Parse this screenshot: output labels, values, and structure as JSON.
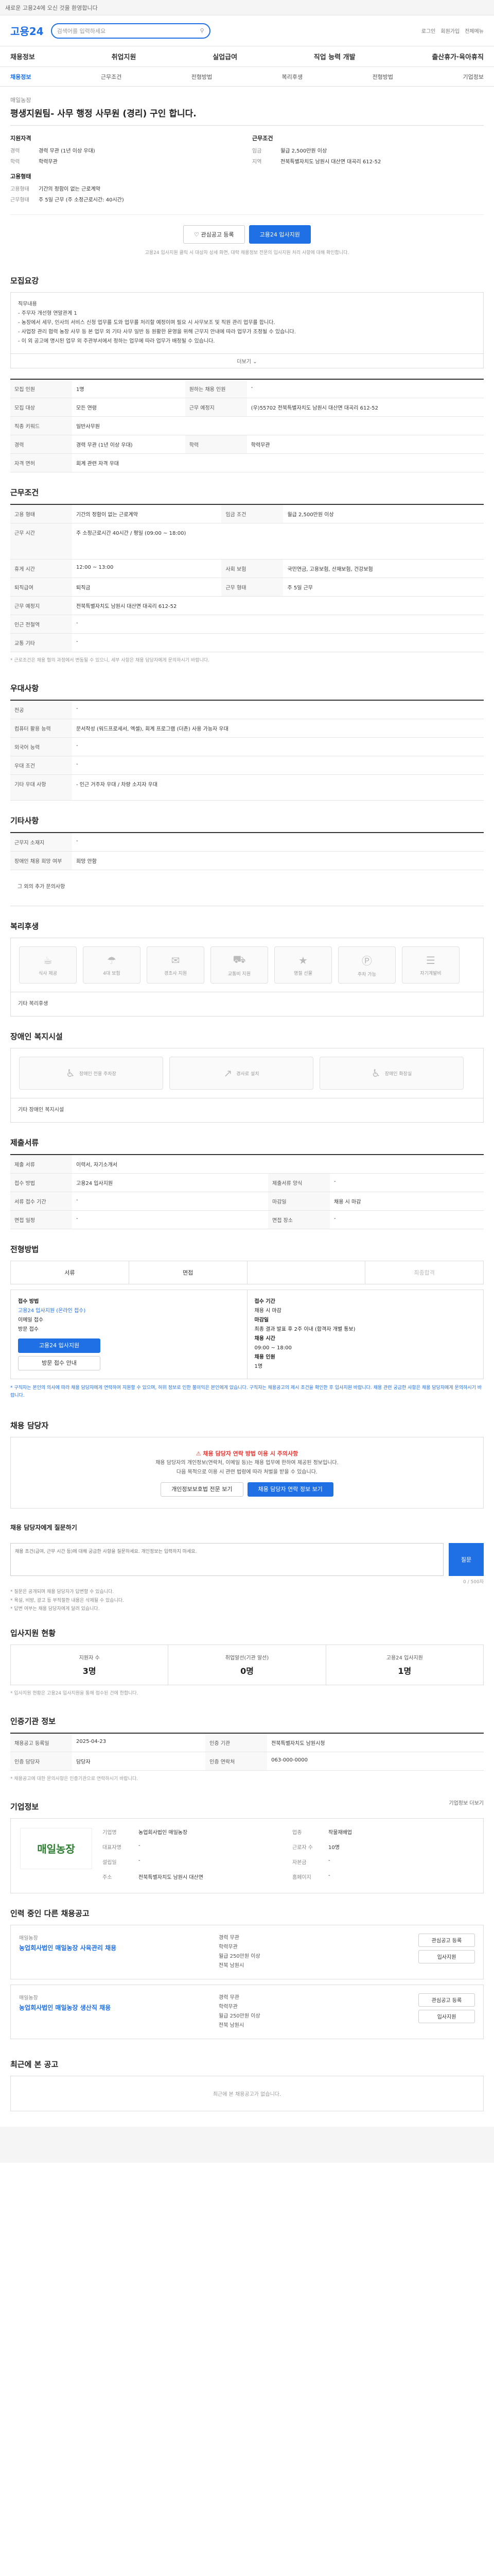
{
  "topbar": {
    "text": "새로운 고용24에 오신 것을 환영합니다"
  },
  "header": {
    "logo": "고용24",
    "search_placeholder": "검색어를 입력하세요",
    "links": [
      "로그인",
      "회원가입",
      "전체메뉴"
    ]
  },
  "gnb": [
    "채용정보",
    "취업지원",
    "실업급여",
    "직업 능력 개발",
    "출산휴가·육아휴직"
  ],
  "tabs": [
    "채용정보",
    "근무조건",
    "전형방법",
    "복리후생",
    "전형방법",
    "기업정보"
  ],
  "job": {
    "company": "매일농장",
    "title": "평생지원팀- 사무 행정 사무원 (경리) 구인 합니다."
  },
  "summary": {
    "left_title": "지원자격",
    "left": [
      {
        "k": "경력",
        "v": "경력 무관 (1년 이상 우대)"
      },
      {
        "k": "학력",
        "v": "학력무관"
      }
    ],
    "left2_title": "고용형태",
    "left2": [
      {
        "k": "고용형태",
        "v": "기간의 정함이 없는 근로계약"
      },
      {
        "k": "근무형태",
        "v": "주 5일 근무 (주 소정근로시간: 40시간)"
      }
    ],
    "right_title": "근무조건",
    "right": [
      {
        "k": "임금",
        "v": "월급 2,500만원 이상"
      },
      {
        "k": "지역",
        "v": "전북특별자치도 남원시 대산면 대곡리 612-52"
      }
    ]
  },
  "actions": {
    "scrap": "관심공고 등록",
    "apply": "고용24 입사지원"
  },
  "apply_note": "고용24 입사지원 클릭 시 대상자 상세 화면, 대략 채용정보 전문의 입사지원 처리 사항에 대해 확인합니다.",
  "recruit_title": "모집요강",
  "recruit_text": [
    "직무내용",
    "- 주무자 개선형 연말관계 1",
    "- 농장에서 세무, 인사의 서비스 신청 업무를 도와 업무를 처리할 예정이며 필요 시 사무보조 및 직원 관리 업무를 합니다.",
    "- 사업장 관리 협력 농장 사무 등 본 업무 외 기타 사무 일반 등 원활한 운영을 위해 근무지 안내에 따라 업무가 조정될 수 있습니다.",
    "- 이 외 공고에 명시된 업무 외 주관부서에서 정하는 업무에 따라 업무가 배정될 수 있습니다."
  ],
  "more_label": "더보기",
  "recruit_table": [
    {
      "k": "모집 인원",
      "v": "1명",
      "k2": "원하는 채용 인원",
      "v2": "-"
    },
    {
      "k": "모집 대상",
      "v": "모든 연령",
      "k2": "근무 예정지",
      "v2": "(우)55702 전북특별자치도 남원시 대산면 대곡리 612-52"
    },
    {
      "k": "직종 키워드",
      "v": "일반사무원",
      "k2": "",
      "v2": ""
    },
    {
      "k": "경력",
      "v": "경력 무관 (1년 이상 우대)",
      "k2": "학력",
      "v2": "학력무관"
    },
    {
      "k": "자격 면허",
      "v": "회계 관련 자격 우대",
      "k2": "",
      "v2": ""
    }
  ],
  "work_title": "근무조건",
  "work_table": [
    {
      "k": "고용 형태",
      "v": "기간의 정함이 없는 근로계약",
      "k2": "임금 조건",
      "v2": "월급 2,500만원 이상"
    },
    {
      "k": "근무 시간",
      "v": "주 소정근로시간 40시간 / 평일 (09:00 ~ 18:00)",
      "k2": "",
      "v2": ""
    },
    {
      "k": "휴게 시간",
      "v": "12:00 ~ 13:00",
      "k2": "사회 보험",
      "v2": "국민연금, 고용보험, 산재보험, 건강보험"
    },
    {
      "k": "퇴직급여",
      "v": "퇴직금",
      "k2": "근무 형태",
      "v2": "주 5일 근무"
    },
    {
      "k": "근무 예정지",
      "v": "전북특별자치도 남원시 대산면 대곡리 612-52",
      "k2": "",
      "v2": ""
    },
    {
      "k": "인근 전철역",
      "v": "-",
      "k2": "",
      "v2": ""
    },
    {
      "k": "교통 기타",
      "v": "-",
      "k2": "",
      "v2": ""
    }
  ],
  "work_note": "* 근로조건은 채용 협의 과정에서 변동될 수 있으니, 세부 사항은 채용 담당자에게 문의하시기 바랍니다.",
  "pref_title": "우대사항",
  "pref_table": [
    {
      "k": "전공",
      "v": "-"
    },
    {
      "k": "컴퓨터 활용 능력",
      "v": "문서작성 (워드프로세서, 엑셀), 회계 프로그램 (더존) 사용 가능자 우대"
    },
    {
      "k": "외국어 능력",
      "v": "-"
    },
    {
      "k": "우대 조건",
      "v": "-"
    },
    {
      "k": "기타 우대 사항",
      "v": "- 인근 거주자 우대 / 차량 소지자 우대"
    }
  ],
  "other_title": "기타사항",
  "other_table": [
    {
      "k": "근무지 소재지",
      "v": "-"
    },
    {
      "k": "장애인 채용 희망 여부",
      "v": "희망 안함"
    }
  ],
  "other_more": "그 외의 추가 문의사항",
  "welfare_title": "복리후생",
  "welfare_icons": [
    "식사 제공",
    "4대 보험",
    "경조사 지원",
    "교통비 지원",
    "명절 선물",
    "주차 가능",
    "자기계발비",
    "휴게실"
  ],
  "welfare_extra_label": "기타 복리후생",
  "disabled_title": "장애인 복지시설",
  "disabled_icons": [
    "장애인 전용 주차장",
    "경사로 설치",
    "장애인 화장실"
  ],
  "disabled_extra_label": "기타 장애인 복지시설",
  "doc_title": "제출서류",
  "doc_table": [
    {
      "k": "제출 서류",
      "v": "이력서, 자기소개서",
      "k2": "",
      "v2": ""
    },
    {
      "k": "접수 방법",
      "v": "고용24 입사지원",
      "k2": "제출서류 양식",
      "v2": "-"
    },
    {
      "k": "서류 접수 기간",
      "v": "-",
      "k2": "마감일",
      "v2": "채용 시 마감"
    },
    {
      "k": "면접 일정",
      "v": "-",
      "k2": "면접 장소",
      "v2": "-"
    }
  ],
  "process_title": "전형방법",
  "process_steps": [
    "서류",
    "면접",
    "",
    "최종합격"
  ],
  "apply_left": [
    "접수 방법",
    "고용24 입사지원 (온라인 접수)",
    "이메일 접수",
    "방문 접수"
  ],
  "apply_left_btns": [
    "고용24 입사지원",
    "방문 접수 안내"
  ],
  "apply_right": [
    "접수 기간",
    "채용 시 마감",
    "마감일",
    "최종 결과 발표 후 2주 이내 (합격자 개별 통보)",
    "채용 시간",
    "09:00 ~ 18:00",
    "채용 인원",
    "1명"
  ],
  "apply_notes": "* 구직자는 본인의 의사에 따라 채용 담당자에게 연락하여 지원할 수 있으며, 허위 정보로 인한 불이익은 본인에게 있습니다. 구직자는 채용공고의 제시 조건을 확인한 후 입사지원 바랍니다. 채용 관련 궁금한 사항은 채용 담당자에게 문의하시기 바랍니다.",
  "contact_title": "채용 담당자",
  "warn": {
    "title": "채용 담당자 연락 방법 이용 시 주의사항",
    "line1": "채용 담당자의 개인정보(연락처, 이메일 등)는 채용 업무에 한하여 제공된 정보입니다.",
    "line2": "다음 목적으로 이용 시 관련 법령에 따라 처벌을 받을 수 있습니다.",
    "btn1": "개인정보보호법 전문 보기",
    "btn2": "채용 담당자 연락 정보 보기"
  },
  "qna_title": "채용 담당자에게 질문하기",
  "qna_placeholder": "채용 조건(급여, 근무 시간 등)에 대해 궁금한 사항을 질문하세요. 개인정보는 입력하지 마세요.",
  "qna_count": "0 / 500자",
  "qna_send": "질문",
  "qna_notes": [
    "* 질문은 공개되며 채용 담당자가 답변할 수 있습니다.",
    "* 욕설, 비방, 광고 등 부적절한 내용은 삭제될 수 있습니다.",
    "* 답변 여부는 채용 담당자에게 달려 있습니다."
  ],
  "status_title": "입사지원 현황",
  "status": [
    {
      "label": "지원자 수",
      "n": "3명"
    },
    {
      "label": "취업알선(기관 알선)",
      "n": "0명"
    },
    {
      "label": "고용24 입사지원",
      "n": "1명"
    }
  ],
  "status_note": "* 입사지원 현황은 고용24 입사지원을 통해 접수된 건에 한합니다.",
  "agency_title": "인증기관 정보",
  "agency_table": [
    {
      "k": "채용공고 등록일",
      "v": "2025-04-23",
      "k2": "인증 기관",
      "v2": "전북특별자치도 남원시청"
    },
    {
      "k": "인증 담당자",
      "v": "담당자",
      "k2": "인증 연락처",
      "v2": "063-000-0000"
    }
  ],
  "agency_note": "* 채용공고에 대한 문의사항은 인증기관으로 연락하시기 바랍니다.",
  "cinfo_title": "기업정보",
  "cinfo_more": "기업정보 더보기",
  "cinfo": {
    "logo": "매일농장",
    "rows": [
      {
        "k": "기업명",
        "v": "농업회사법인 매일농장"
      },
      {
        "k": "업종",
        "v": "작물재배업"
      },
      {
        "k": "대표자명",
        "v": "-"
      },
      {
        "k": "근로자 수",
        "v": "10명"
      },
      {
        "k": "설립일",
        "v": "-"
      },
      {
        "k": "자본금",
        "v": "-"
      },
      {
        "k": "주소",
        "v": "전북특별자치도 남원시 대산면"
      },
      {
        "k": "홈페이지",
        "v": "-"
      }
    ]
  },
  "related_title": "인력 중인 다른 채용공고",
  "related": [
    {
      "company": "매일농장",
      "title": "농업회사법인 매일농장 사육관리 채용",
      "meta": [
        "경력 무관",
        "학력무관",
        "월급 250만원 이상",
        "전북 남원시"
      ],
      "btns": [
        "관심공고 등록",
        "입사지원"
      ]
    },
    {
      "company": "매일농장",
      "title": "농업회사법인 매일농장 생산직 채용",
      "meta": [
        "경력 무관",
        "학력무관",
        "월급 250만원 이상",
        "전북 남원시"
      ],
      "btns": [
        "관심공고 등록",
        "입사지원"
      ]
    }
  ],
  "visited_title": "최근에 본 공고",
  "visited_empty": "최근에 본 채용공고가 없습니다."
}
